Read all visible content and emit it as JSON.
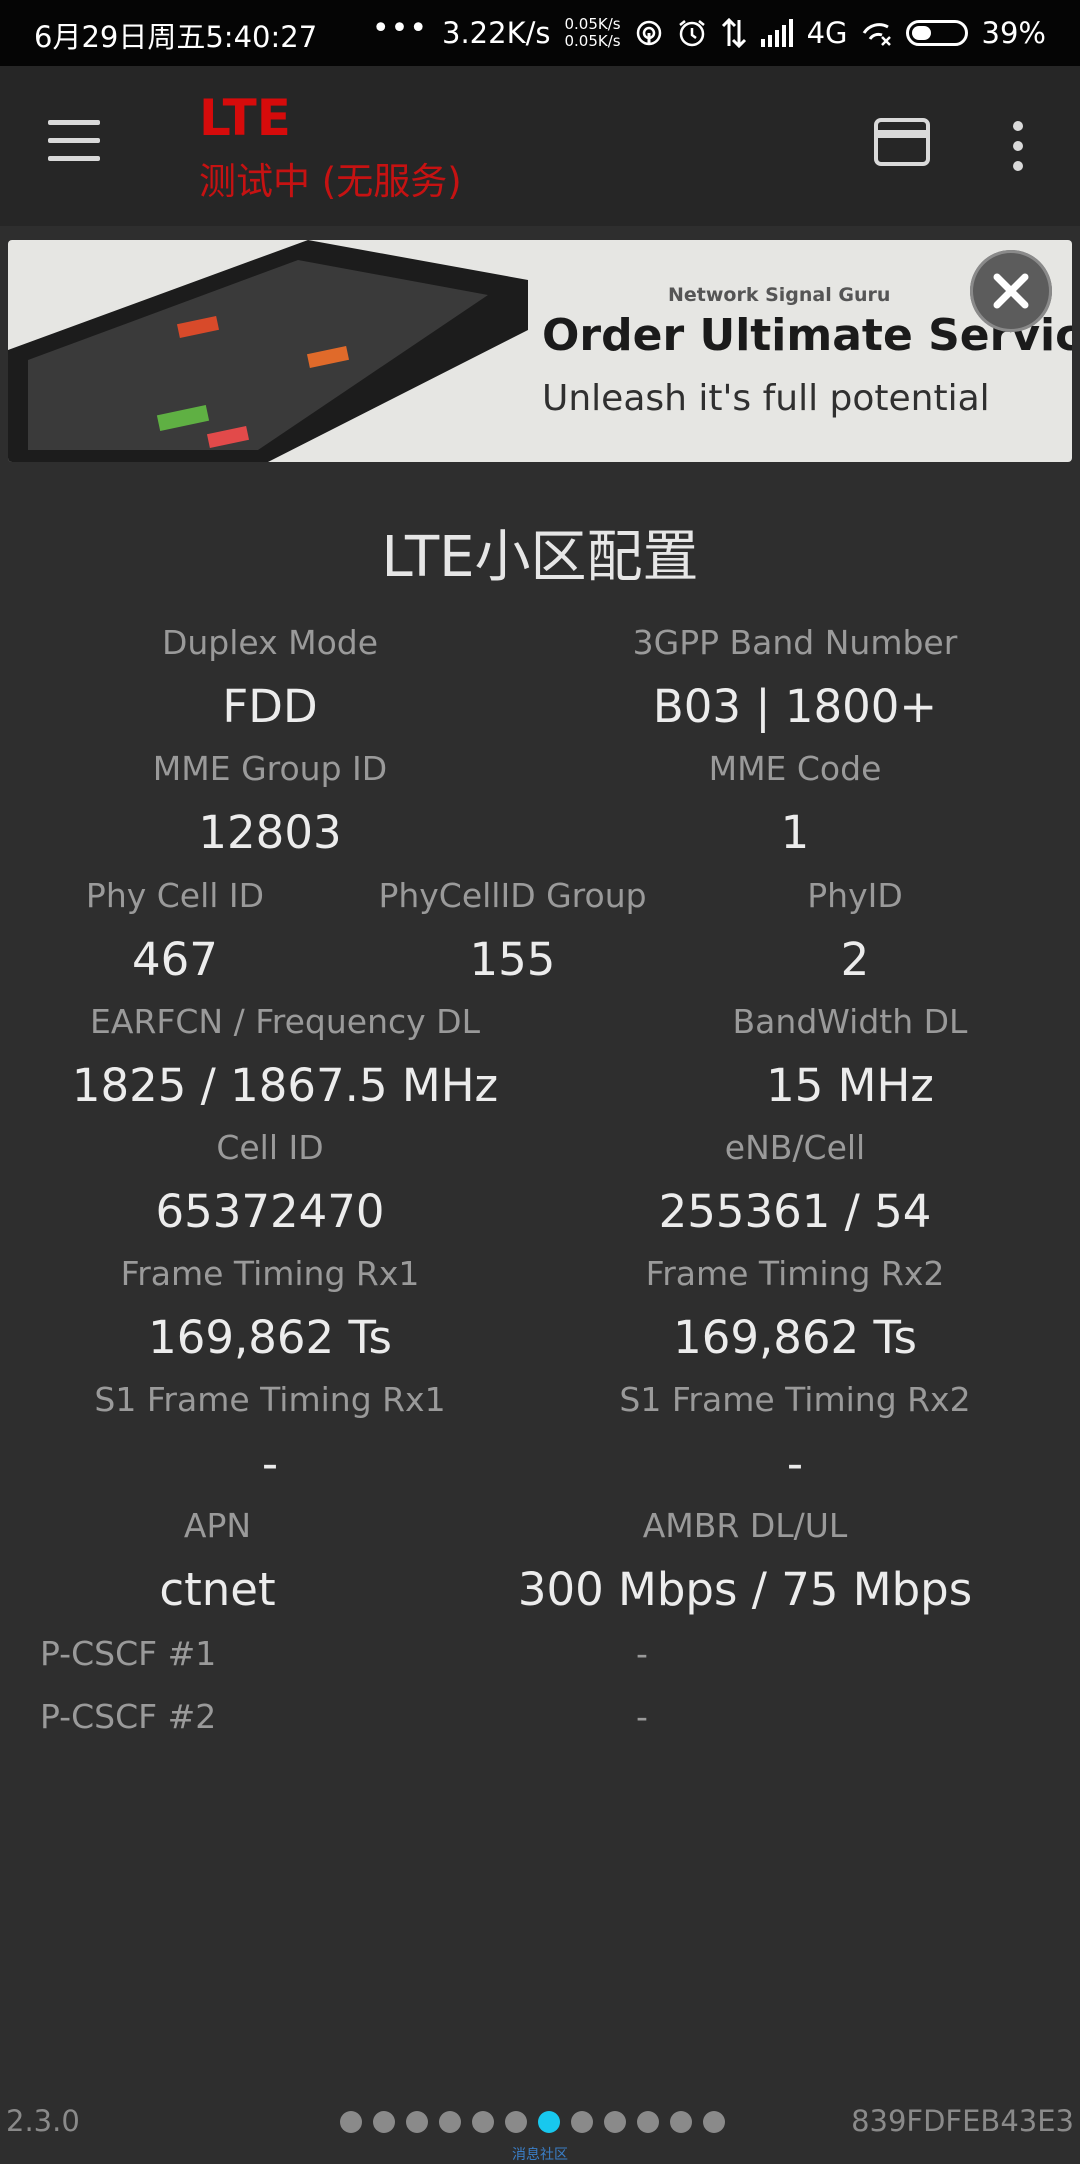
{
  "status_bar": {
    "time": "6月29日周五5:40:27",
    "dots": "•••",
    "speed": "3.22K/s",
    "rate_up": "0.05K/s",
    "rate_down": "0.05K/s",
    "network": "4G",
    "battery": "39%",
    "battery_level": 0.39
  },
  "toolbar": {
    "title": "LTE",
    "subtitle": "测试中 (无服务)",
    "accent": "#d60b0b"
  },
  "ad": {
    "brand": "Network Signal Guru",
    "headline": "Order Ultimate Service",
    "tagline": "Unleash it's full potential"
  },
  "main": {
    "title": "LTE小区配置",
    "duplex_label": "Duplex Mode",
    "duplex_value": "FDD",
    "band_label": "3GPP Band Number",
    "band_value": "B03 | 1800+",
    "mme_group_label": "MME Group ID",
    "mme_group_value": "12803",
    "mme_code_label": "MME Code",
    "mme_code_value": "1",
    "pci_label": "Phy Cell ID",
    "pci_value": "467",
    "pci_group_label": "PhyCellID Group",
    "pci_group_value": "155",
    "phyid_label": "PhyID",
    "phyid_value": "2",
    "earfcn_label": "EARFCN / Frequency DL",
    "earfcn_value": "1825 / 1867.5 MHz",
    "bw_label": "BandWidth DL",
    "bw_value": "15 MHz",
    "cellid_label": "Cell ID",
    "cellid_value": "65372470",
    "enb_label": "eNB/Cell",
    "enb_value": "255361 / 54",
    "ft1_label": "Frame Timing Rx1",
    "ft1_value": "169,862 Ts",
    "ft2_label": "Frame Timing Rx2",
    "ft2_value": "169,862 Ts",
    "s1ft1_label": "S1 Frame Timing Rx1",
    "s1ft1_value": "-",
    "s1ft2_label": "S1 Frame Timing Rx2",
    "s1ft2_value": "-",
    "apn_label": "APN",
    "apn_value": "ctnet",
    "ambr_label": "AMBR DL/UL",
    "ambr_value": "300 Mbps / 75 Mbps",
    "pcscf1_label": "P-CSCF #1",
    "pcscf1_value": "-",
    "pcscf2_label": "P-CSCF #2",
    "pcscf2_value": "-"
  },
  "footer": {
    "version": "2.3.0",
    "device_id": "839FDFEB43E3",
    "page_count": 12,
    "active_page": 7,
    "active_color": "#18c8ee",
    "watermark": "消息社区"
  }
}
